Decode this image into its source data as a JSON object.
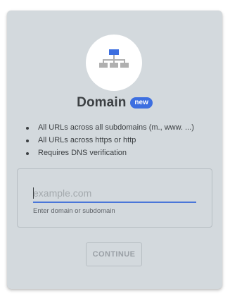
{
  "card": {
    "title": "Domain",
    "badge": "new",
    "icon": "domain-network-icon",
    "features": [
      "All URLs across all subdomains (m., www. ...)",
      "All URLs across https or http",
      "Requires DNS verification"
    ],
    "input": {
      "value": "",
      "placeholder": "example.com",
      "hint": "Enter domain or subdomain"
    },
    "continue_label": "CONTINUE"
  },
  "colors": {
    "card_background": "#d3d9dd",
    "accent": "#3d6fe0",
    "text": "#3c4043"
  }
}
